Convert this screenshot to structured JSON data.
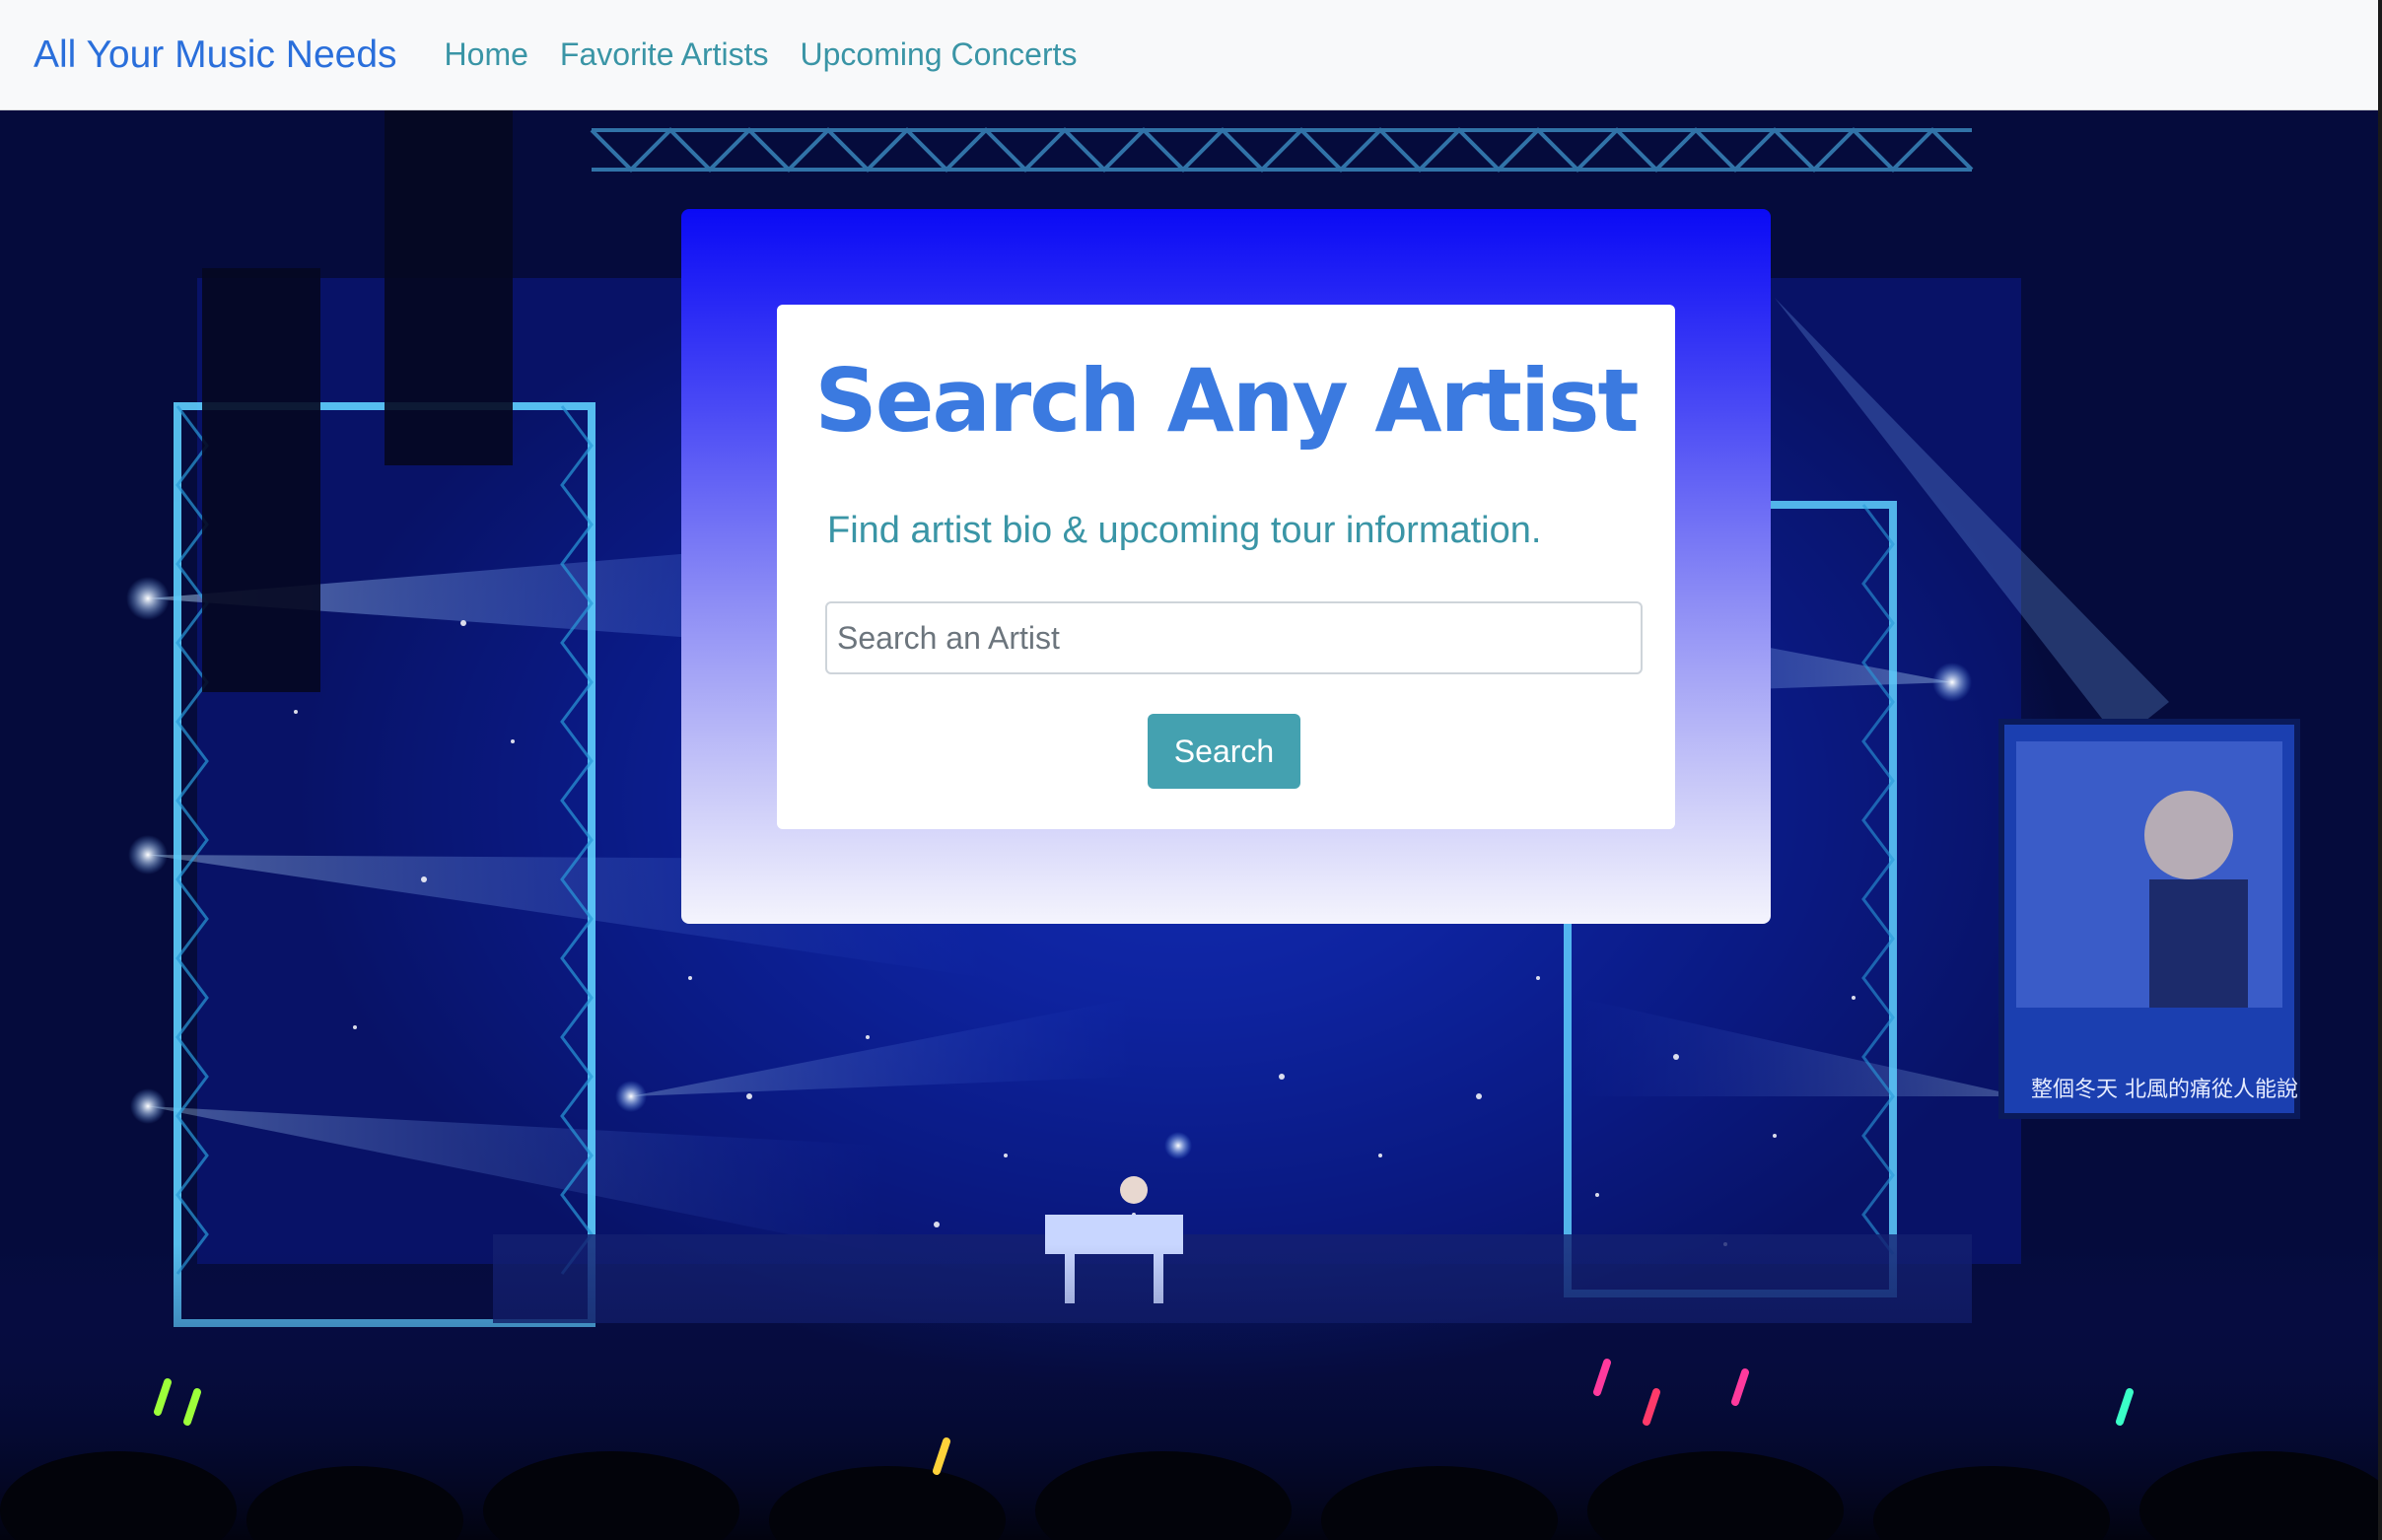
{
  "navbar": {
    "brand": "All Your Music Needs",
    "links": [
      {
        "label": "Home"
      },
      {
        "label": "Favorite Artists"
      },
      {
        "label": "Upcoming Concerts"
      }
    ]
  },
  "hero": {
    "background_scene": "concert-stage-photo",
    "screen_caption": "整個冬天 北風的痛從人能說"
  },
  "search_card": {
    "title": "Search Any Artist",
    "subtitle": "Find artist bio & upcoming tour information.",
    "input_placeholder": "Search an Artist",
    "input_value": "",
    "button_label": "Search"
  },
  "colors": {
    "brand": "#2a6fdb",
    "nav_link": "#3a95a6",
    "title": "#3b7ae0",
    "button": "#44a1b0",
    "card_gradient_top": "#0a0af5",
    "card_gradient_bottom": "#f4f4fd"
  }
}
